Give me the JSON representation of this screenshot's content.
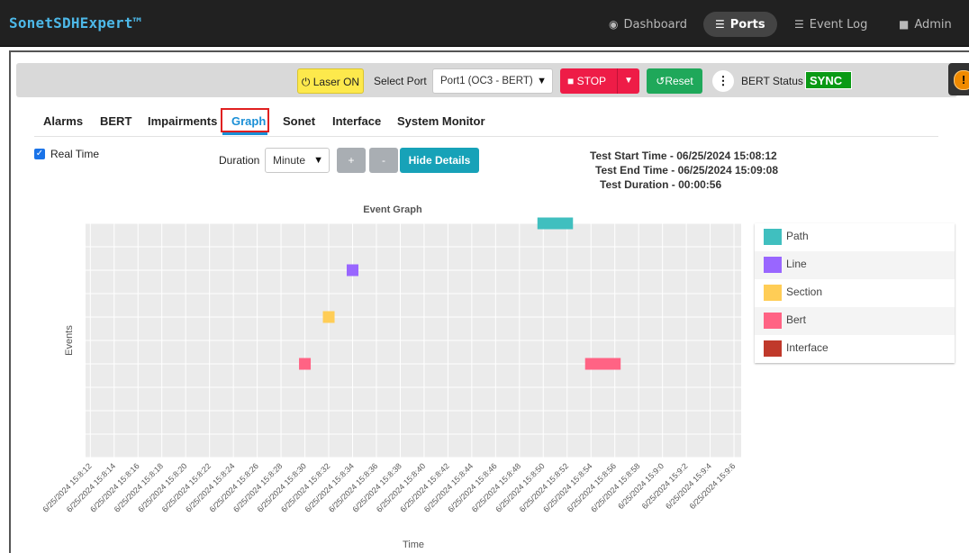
{
  "app": {
    "brand": "SonetSDHExpert™"
  },
  "nav": [
    {
      "label": "Dashboard",
      "icon": "dashboard-icon",
      "active": false
    },
    {
      "label": "Ports",
      "icon": "ports-icon",
      "active": true
    },
    {
      "label": "Event Log",
      "icon": "event-log-icon",
      "active": false
    },
    {
      "label": "Admin",
      "icon": "admin-icon",
      "active": false
    }
  ],
  "toolbar": {
    "laser_label": "Laser ON",
    "select_port_label": "Select Port",
    "port_value": "Port1 (OC3 - BERT)",
    "stop_label": "STOP",
    "reset_label": "Reset",
    "bert_status_label": "BERT Status",
    "bert_status_value": "SYNC"
  },
  "tabs": [
    "Alarms",
    "BERT",
    "Impairments",
    "Graph",
    "Sonet",
    "Interface",
    "System Monitor"
  ],
  "active_tab": "Graph",
  "controls": {
    "real_time_label": "Real Time",
    "real_time_checked": true,
    "duration_label": "Duration",
    "duration_value": "Minute",
    "plus_label": "+",
    "minus_label": "-",
    "hide_details_label": "Hide Details"
  },
  "test_info": {
    "start": "Test Start Time - 06/25/2024 15:08:12",
    "end": "Test End Time - 06/25/2024 15:09:08",
    "duration": "Test Duration - 00:00:56"
  },
  "colors": {
    "accent": "#1a8fd6",
    "stop": "#ee1c47",
    "reset": "#1fa85a",
    "sync": "#0a9a15",
    "laser": "#fde94c"
  },
  "chart_data": {
    "type": "scatter",
    "title": "Event Graph",
    "xlabel": "Time",
    "ylabel": "Events",
    "grid": true,
    "legend_position": "right",
    "categories": [
      "6/25/2024 15:8:12",
      "6/25/2024 15:8:14",
      "6/25/2024 15:8:16",
      "6/25/2024 15:8:18",
      "6/25/2024 15:8:20",
      "6/25/2024 15:8:22",
      "6/25/2024 15:8:24",
      "6/25/2024 15:8:26",
      "6/25/2024 15:8:28",
      "6/25/2024 15:8:30",
      "6/25/2024 15:8:32",
      "6/25/2024 15:8:34",
      "6/25/2024 15:8:36",
      "6/25/2024 15:8:38",
      "6/25/2024 15:8:40",
      "6/25/2024 15:8:42",
      "6/25/2024 15:8:44",
      "6/25/2024 15:8:46",
      "6/25/2024 15:8:48",
      "6/25/2024 15:8:50",
      "6/25/2024 15:8:52",
      "6/25/2024 15:8:54",
      "6/25/2024 15:8:56",
      "6/25/2024 15:8:58",
      "6/25/2024 15:9:0",
      "6/25/2024 15:9:2",
      "6/25/2024 15:9:4",
      "6/25/2024 15:9:6"
    ],
    "series": [
      {
        "name": "Path",
        "color": "#40bfbf",
        "points": [
          {
            "x": "6/25/2024 15:8:50",
            "x_end": "6/25/2024 15:8:52"
          }
        ]
      },
      {
        "name": "Line",
        "color": "#9966ff",
        "points": [
          {
            "x": "6/25/2024 15:8:34"
          }
        ]
      },
      {
        "name": "Section",
        "color": "#ffcd56",
        "points": [
          {
            "x": "6/25/2024 15:8:32"
          }
        ]
      },
      {
        "name": "Bert",
        "color": "#ff6384",
        "points": [
          {
            "x": "6/25/2024 15:8:30"
          },
          {
            "x": "6/25/2024 15:8:54",
            "x_end": "6/25/2024 15:8:56"
          }
        ]
      },
      {
        "name": "Interface",
        "color": "#c0392b",
        "points": []
      }
    ]
  }
}
